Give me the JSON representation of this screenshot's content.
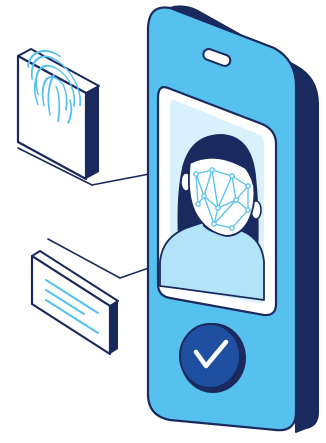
{
  "illustration": {
    "subject": "face-id-verification",
    "icons": [
      "fingerprint-icon",
      "face-scan-icon",
      "text-lines-icon",
      "checkmark-icon"
    ]
  },
  "colors": {
    "phone_body": "#56c1ef",
    "phone_dark": "#1b2a5e",
    "outline": "#1b2a5e",
    "screen": "#ffffff",
    "photo_bg": "#d9f1fc",
    "hair": "#1b2a5e",
    "shirt": "#b3e3f8",
    "skin": "#ffffff",
    "mesh": "#56c1ef",
    "check_button": "#1e4fa0",
    "accent_light": "#9bdaf5"
  },
  "status": {
    "verified": true
  }
}
